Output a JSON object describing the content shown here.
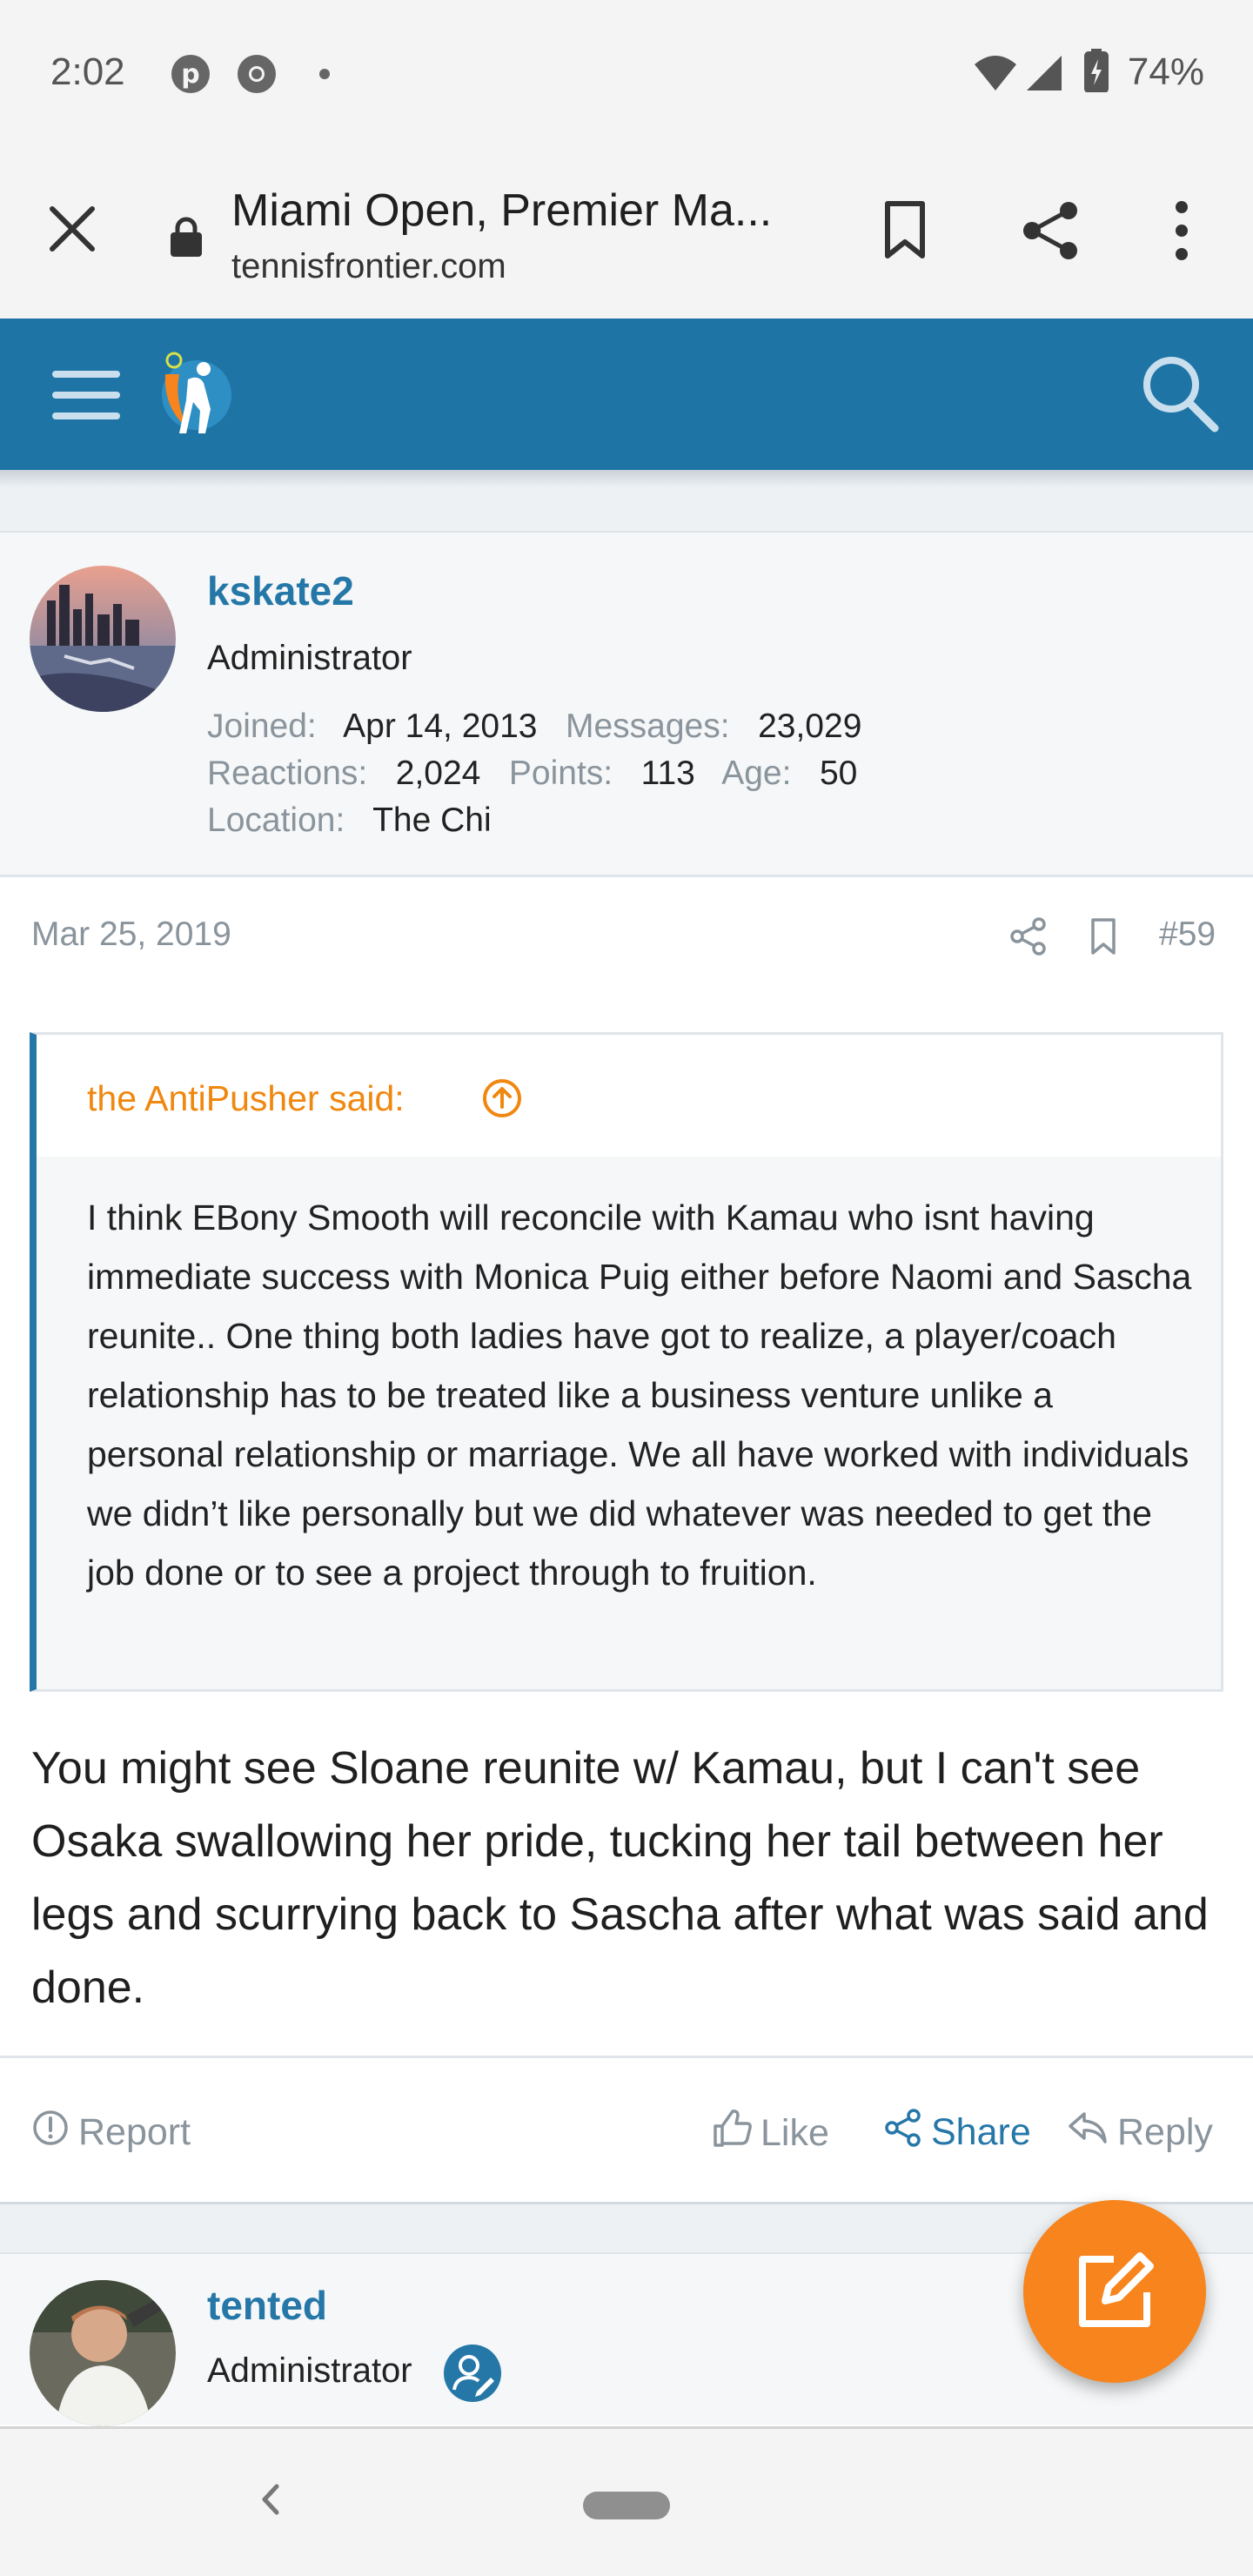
{
  "status_bar": {
    "time": "2:02",
    "battery": "74%"
  },
  "tab": {
    "title": "Miami Open, Premier Ma...",
    "domain": "tennisfrontier.com"
  },
  "post": {
    "username": "kskate2",
    "user_title": "Administrator",
    "stats": {
      "joined_label": "Joined:",
      "joined": "Apr 14, 2013",
      "messages_label": "Messages:",
      "messages": "23,029",
      "reactions_label": "Reactions:",
      "reactions": "2,024",
      "points_label": "Points:",
      "points": "113",
      "age_label": "Age:",
      "age": "50",
      "location_label": "Location:",
      "location": "The Chi"
    },
    "date": "Mar 25, 2019",
    "number": "#59",
    "quote": {
      "author": "the AntiPusher said:",
      "text": "I think EBony Smooth will reconcile with Kamau who isnt having immediate success with Monica Puig either before Naomi and Sascha reunite.. One thing both ladies have got to realize, a player/coach relationship has to be treated like a business venture unlike a personal relationship or marriage. We all have worked with individuals we didn’t like personally but we did whatever was needed to get the job done or to see a project through to fruition."
    },
    "message": "You might see Sloane reunite w/ Kamau, but I can't see Osaka swallowing her pride, tucking her tail between her legs and scurrying back to Sascha after what was said and done.",
    "actions": {
      "report": "Report",
      "like": "Like",
      "share": "Share",
      "reply": "Reply"
    }
  },
  "next_post": {
    "username": "tented",
    "user_title": "Administrator"
  },
  "colors": {
    "brand_blue": "#1f74a6",
    "link_blue": "#2577a8",
    "quote_orange": "#f0870f",
    "fab_orange": "#f7841d"
  },
  "icons": [
    "pinterest-icon",
    "chrome-icon",
    "wifi-icon",
    "signal-icon",
    "battery-icon",
    "close-icon",
    "lock-icon",
    "bookmark-icon",
    "share-icon",
    "more-icon",
    "hamburger-icon",
    "logo-icon",
    "search-icon",
    "arrow-up-circle-icon",
    "report-icon",
    "thumbs-up-icon",
    "reply-icon",
    "staff-badge-icon",
    "edit-icon",
    "back-icon"
  ]
}
